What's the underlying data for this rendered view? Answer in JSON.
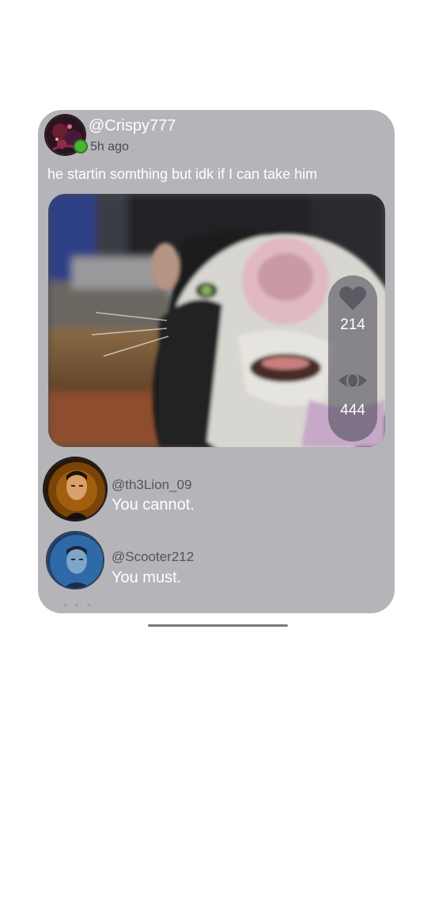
{
  "post": {
    "username": "@Crispy777",
    "time": "5h ago",
    "caption": "he startin somthing but idk if I can take him",
    "stats": {
      "likes": "214",
      "views": "444",
      "like_icon": "heart-icon",
      "view_icon": "eye-icon"
    }
  },
  "comments": [
    {
      "username": "@th3Lion_09",
      "text": "You cannot."
    },
    {
      "username": "@Scooter212",
      "text": "You must."
    }
  ],
  "colors": {
    "card_background": "#b5b4b9",
    "online_indicator": "#47b52f",
    "text_primary": "#ffffff",
    "text_secondary": "#55535a"
  }
}
